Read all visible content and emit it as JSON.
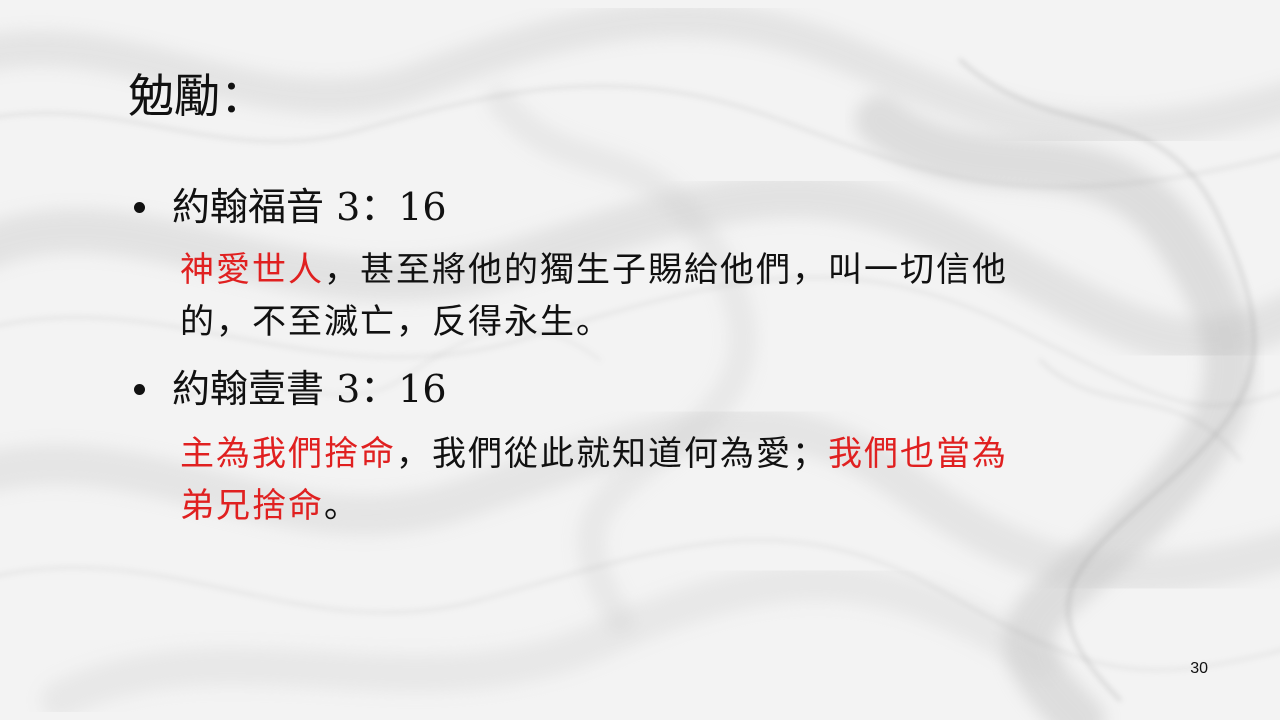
{
  "slide": {
    "title": "勉勵：",
    "page_number": "30"
  },
  "bullets": [
    {
      "reference": "約翰福音 3：16",
      "lines": [
        [
          {
            "text": "神愛世人",
            "color": "red"
          },
          {
            "text": "，甚至將他的獨生子賜給他們，叫一切信他",
            "color": "black"
          }
        ],
        [
          {
            "text": "的，不至滅亡，反得永生。",
            "color": "black"
          }
        ]
      ]
    },
    {
      "reference": "約翰壹書 3：16",
      "lines": [
        [
          {
            "text": "主為我們捨命",
            "color": "red"
          },
          {
            "text": "，我們從此就知道何為愛；",
            "color": "black"
          },
          {
            "text": "我們也當為",
            "color": "red"
          }
        ],
        [
          {
            "text": "弟兄捨命",
            "color": "red"
          },
          {
            "text": "。",
            "color": "black"
          }
        ]
      ]
    }
  ],
  "colors": {
    "accent_red": "#e02020",
    "text": "#111111",
    "background": "#f4f4f4"
  }
}
